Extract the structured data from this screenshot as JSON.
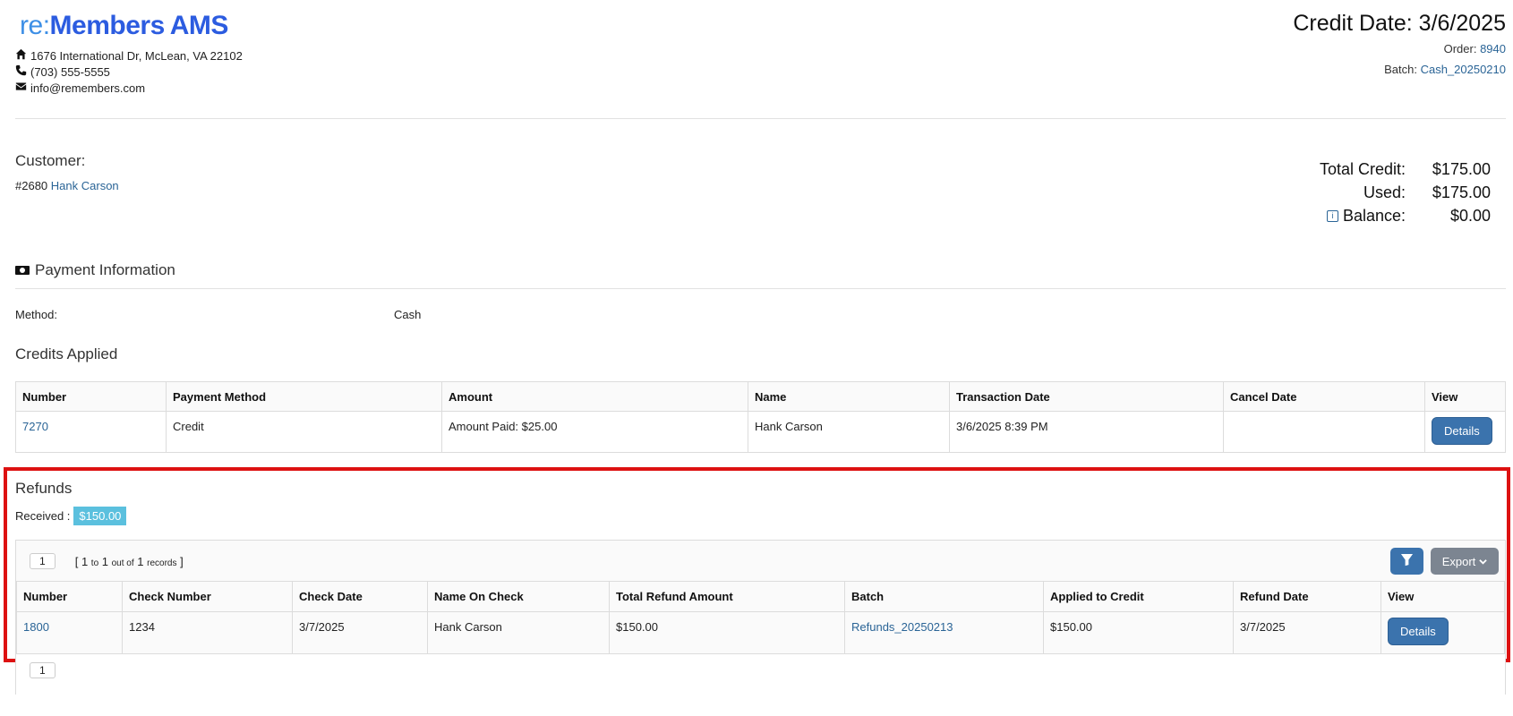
{
  "logo": {
    "re": "re",
    "colon": ":",
    "members": "Members",
    "ams": "AMS"
  },
  "contact": {
    "address": "1676 International Dr, McLean, VA 22102",
    "phone": "(703) 555-5555",
    "email": "info@remembers.com"
  },
  "header": {
    "credit_date_label": "Credit Date:",
    "credit_date": "3/6/2025",
    "order_label": "Order:",
    "order": "8940",
    "batch_label": "Batch:",
    "batch": "Cash_20250210"
  },
  "customer": {
    "title": "Customer:",
    "id": "#2680",
    "name": "Hank Carson"
  },
  "totals": {
    "total_credit_label": "Total Credit:",
    "total_credit": "$175.00",
    "used_label": "Used:",
    "used": "$175.00",
    "balance_label": "Balance:",
    "balance": "$0.00",
    "info_icon_glyph": "i"
  },
  "payment": {
    "title": "Payment Information",
    "method_label": "Method:",
    "method": "Cash"
  },
  "credits_applied": {
    "title": "Credits Applied",
    "columns": [
      "Number",
      "Payment Method",
      "Amount",
      "Name",
      "Transaction Date",
      "Cancel Date",
      "View"
    ],
    "rows": [
      {
        "number": "7270",
        "payment_method": "Credit",
        "amount": "Amount Paid: $25.00",
        "name": "Hank Carson",
        "transaction_date": "3/6/2025 8:39 PM",
        "cancel_date": "",
        "view_label": "Details"
      }
    ]
  },
  "refunds": {
    "title": "Refunds",
    "received_label": "Received :",
    "received_value": "$150.00",
    "pager": {
      "page": "1",
      "open": "[",
      "from": "1",
      "to_word": "to",
      "to": "1",
      "out_of_word": "out of",
      "total": "1",
      "records_word": "records",
      "close": "]"
    },
    "export_label": "Export",
    "columns": [
      "Number",
      "Check Number",
      "Check Date",
      "Name On Check",
      "Total Refund Amount",
      "Batch",
      "Applied to Credit",
      "Refund Date",
      "View"
    ],
    "rows": [
      {
        "number": "1800",
        "check_number": "1234",
        "check_date": "3/7/2025",
        "name_on_check": "Hank Carson",
        "total_refund_amount": "$150.00",
        "batch": "Refunds_20250213",
        "applied_to_credit": "$150.00",
        "refund_date": "3/7/2025",
        "view_label": "Details"
      }
    ],
    "bottom_page": "1"
  },
  "colors": {
    "link": "#2a6496",
    "primary_button": "#3b73ad",
    "export_button": "#7c8591",
    "badge": "#5bc0de",
    "highlight": "#dd1111"
  }
}
